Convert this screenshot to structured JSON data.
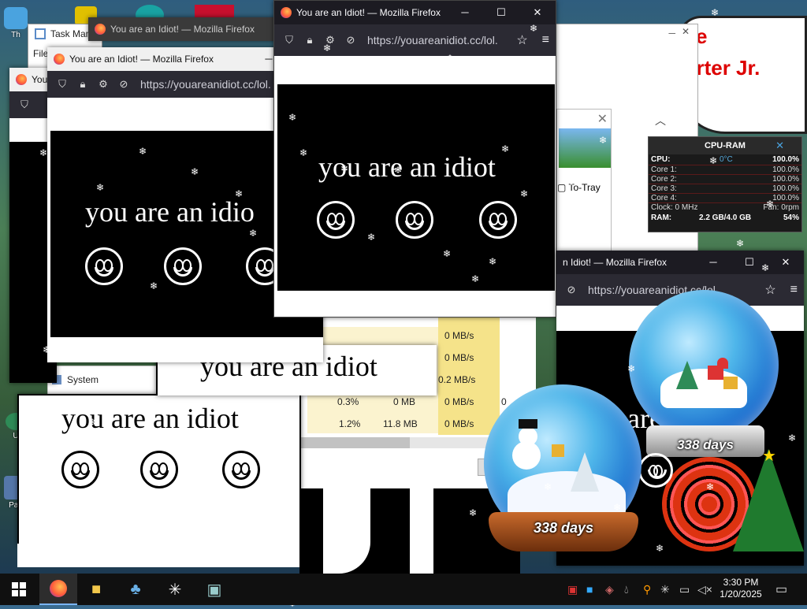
{
  "desktop": {
    "icons": [
      {
        "label": "Th"
      },
      {
        "label": "U"
      },
      {
        "label": "Pap"
      }
    ],
    "banner_text": "arter Jr."
  },
  "windows": {
    "ff_title": "You are an Idiot! — Mozilla Firefox",
    "ff_title_short": "You",
    "ff_title_partial": "n Idiot! — Mozilla Firefox",
    "url": "https://youareanidiot.cc/lol.",
    "url_partial": "https://youareanidiot.cc/lol.",
    "url_short": "https://youareanidiot.cc/lol.",
    "message": "you are an idiot",
    "message_cut": "you are an idio",
    "message_tail": "are",
    "minimize": "─",
    "maximize": "☐",
    "close": "✕"
  },
  "taskmanager": {
    "title": "Task Manager",
    "menu_file": "File",
    "process_system": "System",
    "cells": [
      {
        "text": "0 MB/s"
      },
      {
        "text": "0 MB/s"
      },
      {
        "text": "0.2 MB/s"
      },
      {
        "text": "0.3%"
      },
      {
        "text": "0 MB"
      },
      {
        "text": "0 MB/s"
      },
      {
        "text": "0"
      },
      {
        "text": "1.2%"
      },
      {
        "text": "11.8 MB"
      },
      {
        "text": "0 MB/s"
      }
    ]
  },
  "dialog": {
    "to_tray": "To-Tray"
  },
  "cpuram": {
    "title": "CPU-RAM",
    "cpu_label": "CPU:",
    "cpu_temp": "0°C",
    "cpu_pct": "100.0%",
    "cores": [
      {
        "label": "Core 1:",
        "value": "100.0%"
      },
      {
        "label": "Core 2:",
        "value": "100.0%"
      },
      {
        "label": "Core 3:",
        "value": "100.0%"
      },
      {
        "label": "Core 4:",
        "value": "100.0%"
      }
    ],
    "clock": "Clock: 0 MHz",
    "fan": "Fan: 0rpm",
    "ram_label": "RAM:",
    "ram_value": "2.2 GB/4.0 GB",
    "ram_pct": "54%"
  },
  "widgets": {
    "globe1_days": "338 days",
    "globe2_days": "338 days"
  },
  "taskbar": {
    "time": "3:30 PM",
    "date": "1/20/2025"
  }
}
